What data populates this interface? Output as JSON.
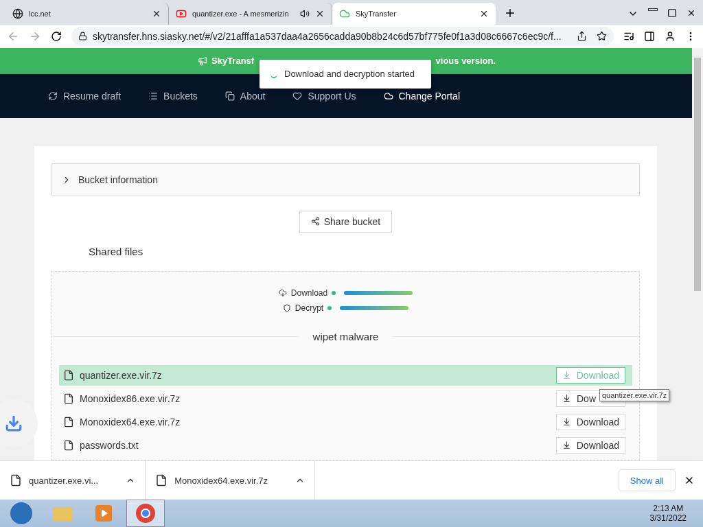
{
  "browser_tabs": [
    {
      "title": "lcc.net",
      "selected": false
    },
    {
      "title": "quantizer.exe - A mesmerizin",
      "selected": false,
      "audio": true
    },
    {
      "title": "SkyTransfer",
      "selected": true
    }
  ],
  "address": "skytransfer.hns.siasky.net/#/v2/21afffa1a537daa4a2656cadda90b8b24c6d57bf775fe0f1a3d08c6667c6ec9c/f...",
  "banner": {
    "text_start": "SkyTransf",
    "text_end": "vious version."
  },
  "toast": "Download and decryption started",
  "nav": [
    {
      "label": "Resume draft",
      "selected": false
    },
    {
      "label": "Buckets",
      "selected": false
    },
    {
      "label": "About",
      "selected": false
    },
    {
      "label": "Support Us",
      "selected": false
    },
    {
      "label": "Change Portal",
      "selected": true
    }
  ],
  "bucket_info": {
    "label": "Bucket information",
    "expanded": false
  },
  "share_button": "Share bucket",
  "section_title": "Shared files",
  "progress": [
    {
      "label": "Download",
      "level": 1
    },
    {
      "label": "Decrypt",
      "level": 1
    }
  ],
  "bucket_name": "wipet malware",
  "files": [
    {
      "name": "quantizer.exe.vir.7z",
      "button": "Download",
      "highlighted": true
    },
    {
      "name": "Monoxidex86.exe.vir.7z",
      "button": "Dow",
      "highlighted": false
    },
    {
      "name": "Monoxidex64.exe.vir.7z",
      "button": "Download",
      "highlighted": false
    },
    {
      "name": "passwords.txt",
      "button": "Download",
      "highlighted": false
    }
  ],
  "tooltip": "quantizer.exe.vir.7z",
  "downloads": [
    {
      "name": "quantizer.exe.vi..."
    },
    {
      "name": "Monoxidex64.exe.vir.7z"
    }
  ],
  "show_all": "Show all",
  "clock": {
    "time": "2:13 AM",
    "date": "3/31/2022"
  }
}
